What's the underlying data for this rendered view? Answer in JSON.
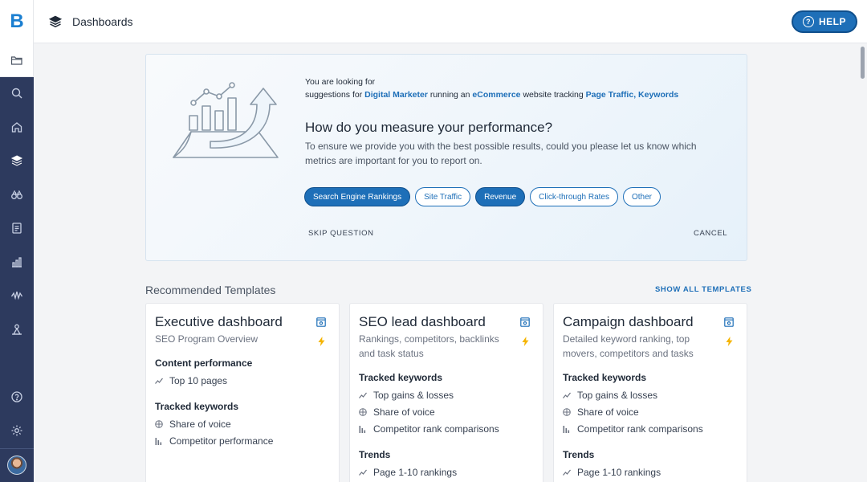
{
  "app": {
    "logo": "B",
    "page_title": "Dashboards",
    "help_label": "HELP"
  },
  "sidebar": {
    "items": [
      "folder-icon",
      "search-icon",
      "home-icon",
      "layers-icon",
      "binoculars-icon",
      "report-icon",
      "bar-chart-icon",
      "signal-icon",
      "org-chart-icon",
      "help-circle-icon",
      "settings-icon"
    ]
  },
  "question": {
    "intro_line1": "You are looking for",
    "intro_prefix": "suggestions for",
    "role": "Digital Marketer",
    "running": "running an",
    "site_type": "eCommerce",
    "tracking": "website tracking",
    "metric1": "Page Traffic",
    "comma": ",",
    "metric2": "Keywords",
    "title": "How do you measure your performance?",
    "description": "To ensure we provide you with the best possible results, could you please let us know which metrics are important for you to report on.",
    "chips": [
      {
        "label": "Search Engine Rankings",
        "selected": true
      },
      {
        "label": "Site Traffic",
        "selected": false
      },
      {
        "label": "Revenue",
        "selected": true
      },
      {
        "label": "Click-through Rates",
        "selected": false
      },
      {
        "label": "Other",
        "selected": false
      }
    ],
    "skip_label": "SKIP QUESTION",
    "cancel_label": "CANCEL"
  },
  "templates": {
    "heading": "Recommended Templates",
    "show_all": "SHOW ALL TEMPLATES",
    "cards": [
      {
        "title": "Executive dashboard",
        "subtitle": "SEO Program Overview",
        "sections": [
          {
            "heading": "Content performance",
            "items": [
              {
                "icon": "trend-icon",
                "label": "Top 10 pages"
              }
            ]
          },
          {
            "heading": "Tracked keywords",
            "items": [
              {
                "icon": "globe-icon",
                "label": "Share of voice"
              },
              {
                "icon": "bars-icon",
                "label": "Competitor performance"
              }
            ]
          }
        ]
      },
      {
        "title": "SEO lead dashboard",
        "subtitle": "Rankings, competitors, backlinks and task status",
        "sections": [
          {
            "heading": "Tracked keywords",
            "items": [
              {
                "icon": "trend-icon",
                "label": "Top gains & losses"
              },
              {
                "icon": "globe-icon",
                "label": "Share of voice"
              },
              {
                "icon": "bars-icon",
                "label": "Competitor rank comparisons"
              }
            ]
          },
          {
            "heading": "Trends",
            "items": [
              {
                "icon": "trend-icon",
                "label": "Page 1-10 rankings"
              }
            ]
          }
        ]
      },
      {
        "title": "Campaign dashboard",
        "subtitle": "Detailed keyword ranking, top movers, competitors and tasks",
        "sections": [
          {
            "heading": "Tracked keywords",
            "items": [
              {
                "icon": "trend-icon",
                "label": "Top gains & losses"
              },
              {
                "icon": "globe-icon",
                "label": "Share of voice"
              },
              {
                "icon": "bars-icon",
                "label": "Competitor rank comparisons"
              }
            ]
          },
          {
            "heading": "Trends",
            "items": [
              {
                "icon": "trend-icon",
                "label": "Page 1-10 rankings"
              }
            ]
          }
        ]
      }
    ]
  },
  "colors": {
    "accent": "#1e6fb8",
    "sidebar": "#2d3a5e"
  }
}
